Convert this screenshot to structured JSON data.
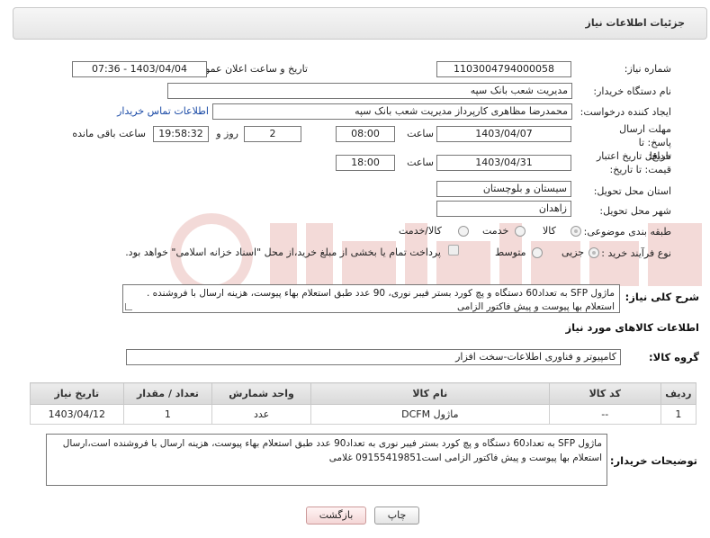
{
  "header": {
    "title": "جزئیات اطلاعات نیاز"
  },
  "fields": {
    "need_number": {
      "label": "شماره نیاز:",
      "value": "1103004794000058"
    },
    "announce_datetime": {
      "label": "تاریخ و ساعت اعلان عمومی:",
      "value": "1403/04/04 - 07:36"
    },
    "buyer_org": {
      "label": "نام دستگاه خریدار:",
      "value": "مدیریت شعب بانک سپه"
    },
    "requester": {
      "label": "ایجاد کننده درخواست:",
      "value": "محمدرضا مظاهری کارپرداز مدیریت شعب بانک سپه",
      "contact_link": "اطلاعات تماس خریدار"
    },
    "reply_deadline": {
      "label": "مهلت ارسال پاسخ: تا تاریخ:",
      "date": "1403/04/07",
      "time_label": "ساعت",
      "time": "08:00",
      "days": "2",
      "days_label": "روز و",
      "remaining": "19:58:32",
      "remaining_label": "ساعت باقی مانده"
    },
    "price_validity": {
      "label": "حداقل تاریخ اعتبار قیمت: تا تاریخ:",
      "date": "1403/04/31",
      "time_label": "ساعت",
      "time": "18:00"
    },
    "delivery_province": {
      "label": "استان محل تحویل:",
      "value": "سیستان و بلوچستان"
    },
    "delivery_city": {
      "label": "شهر محل تحویل:",
      "value": "زاهدان"
    },
    "category": {
      "label": "طبقه بندی موضوعی:",
      "options": [
        "کالا",
        "خدمت",
        "کالا/خدمت"
      ],
      "selected": "کالا"
    },
    "purchase_type": {
      "label": "نوع فرآیند خرید :",
      "options": [
        "جزیی",
        "متوسط"
      ],
      "selected": "جزیی",
      "payment_note": "پرداخت تمام یا بخشی از مبلغ خرید،از محل \"اسناد خزانه اسلامی\" خواهد بود."
    }
  },
  "general_description": {
    "label": "شرح کلی نیاز:",
    "text": "ماژول SFP به تعداد60 دستگاه و پچ کورد بستر فیبر نوری، 90 عدد طبق استعلام بهاء پیوست، هزینه ارسال با فروشنده . استعلام بها پیوست و پیش فاکتور الزامی"
  },
  "goods_section": {
    "title": "اطلاعات کالاهای مورد نیاز",
    "group_label": "گروه کالا:",
    "group_value": "کامپیوتر و فناوری اطلاعات-سخت افزار",
    "table": {
      "headers": [
        "ردیف",
        "کد کالا",
        "نام کالا",
        "واحد شمارش",
        "تعداد / مقدار",
        "تاریخ نیاز"
      ],
      "rows": [
        [
          "1",
          "--",
          "ماژول DCFM",
          "عدد",
          "1",
          "1403/04/12"
        ]
      ]
    }
  },
  "buyer_notes": {
    "label": "توضیحات خریدار:",
    "text": "ماژول SFP به تعداد60 دستگاه و پچ کورد بستر فیبر نوری به تعداد90 عدد طبق استعلام بهاء پیوست، هزینه ارسال با فروشنده است،ارسال استعلام بها پیوست و پیش فاکتور الزامی است09155419851 غلامی"
  },
  "buttons": {
    "print": "چاپ",
    "back": "بازگشت"
  },
  "colors": {
    "link": "#1a4aa6",
    "back_button": "#f4d6d6",
    "watermark": "#c0392b"
  }
}
